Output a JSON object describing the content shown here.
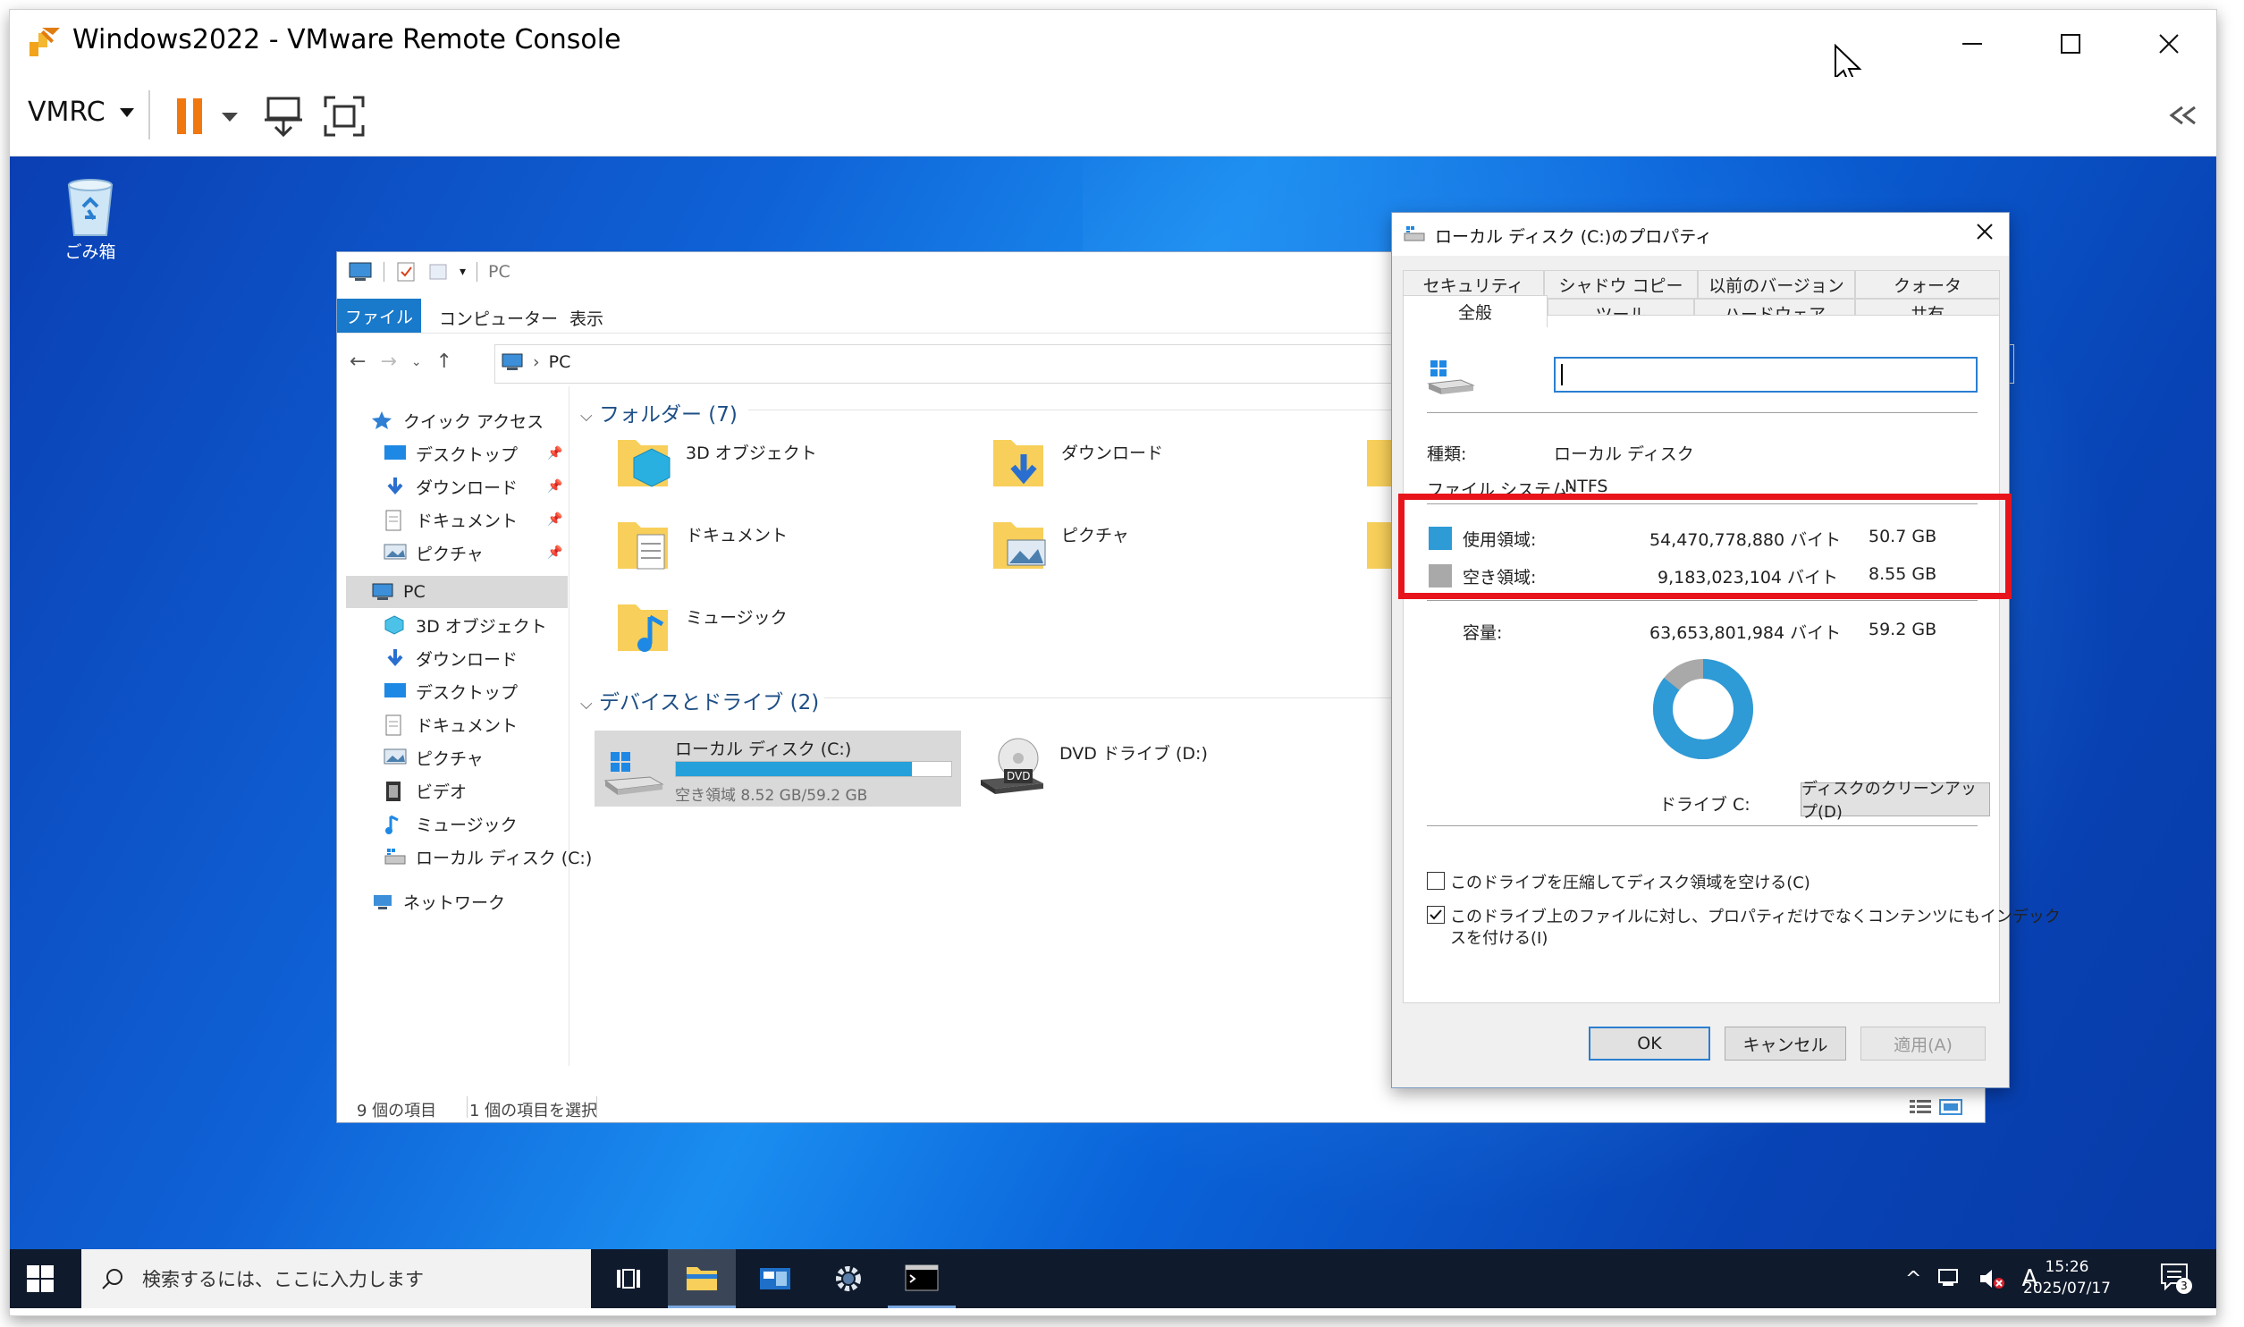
{
  "window": {
    "title": "Windows2022 - VMware Remote Console",
    "menu_label": "VMRC"
  },
  "desktop": {
    "recycle_bin_label": "ごみ箱"
  },
  "explorer": {
    "qat_title": "PC",
    "ribbon_tabs": [
      "ファイル",
      "コンピューター",
      "表示"
    ],
    "address": "PC",
    "nav": {
      "quick_access": "クイック アクセス",
      "quick_items": [
        "デスクトップ",
        "ダウンロード",
        "ドキュメント",
        "ピクチャ"
      ],
      "pc": "PC",
      "pc_items": [
        "3D オブジェクト",
        "ダウンロード",
        "デスクトップ",
        "ドキュメント",
        "ピクチャ",
        "ビデオ",
        "ミュージック",
        "ローカル ディスク (C:)"
      ],
      "network": "ネットワーク"
    },
    "folders_header": "フォルダー (7)",
    "folders": [
      "3D オブジェクト",
      "ダウンロード",
      "ドキュメント",
      "ピクチャ",
      "ミュージック"
    ],
    "drives_header": "デバイスとドライブ (2)",
    "drive_c": {
      "name": "ローカル ディスク (C:)",
      "free_text": "空き領域 8.52 GB/59.2 GB",
      "used_fraction": 0.856
    },
    "drive_d": {
      "name": "DVD ドライブ (D:)",
      "badge": "DVD"
    },
    "status": {
      "item_count": "9 個の項目",
      "selected": "1 個の項目を選択"
    }
  },
  "properties": {
    "title": "ローカル ディスク (C:)のプロパティ",
    "tabs_row1": [
      "セキュリティ",
      "シャドウ コピー",
      "以前のバージョン",
      "クォータ"
    ],
    "tabs_row2": [
      "全般",
      "ツール",
      "ハードウェア",
      "共有"
    ],
    "name_value": "",
    "type_label": "種類:",
    "type_value": "ローカル ディスク",
    "fs_label": "ファイル システム:",
    "fs_value": "NTFS",
    "used_label": "使用領域:",
    "used_bytes": "54,470,778,880 バイト",
    "used_gb": "50.7 GB",
    "free_label": "空き領域:",
    "free_bytes": "9,183,023,104 バイト",
    "free_gb": "8.55 GB",
    "capacity_label": "容量:",
    "capacity_bytes": "63,653,801,984 バイト",
    "capacity_gb": "59.2 GB",
    "drive_label": "ドライブ C:",
    "cleanup_button": "ディスクのクリーンアップ(D)",
    "compress_checkbox": "このドライブを圧縮してディスク領域を空ける(C)",
    "index_checkbox_line1": "このドライブ上のファイルに対し、プロパティだけでなくコンテンツにもインデック",
    "index_checkbox_line2": "スを付ける(I)",
    "compress_checked": false,
    "index_checked": true,
    "ok": "OK",
    "cancel": "キャンセル",
    "apply": "適用(A)",
    "colors": {
      "used": "#2e9ad6",
      "free": "#a9a9a9"
    },
    "used_fraction": 0.856
  },
  "taskbar": {
    "search_placeholder": "検索するには、ここに入力します",
    "ime": "A",
    "time": "15:26",
    "date": "2025/07/17",
    "notification_count": "3"
  }
}
